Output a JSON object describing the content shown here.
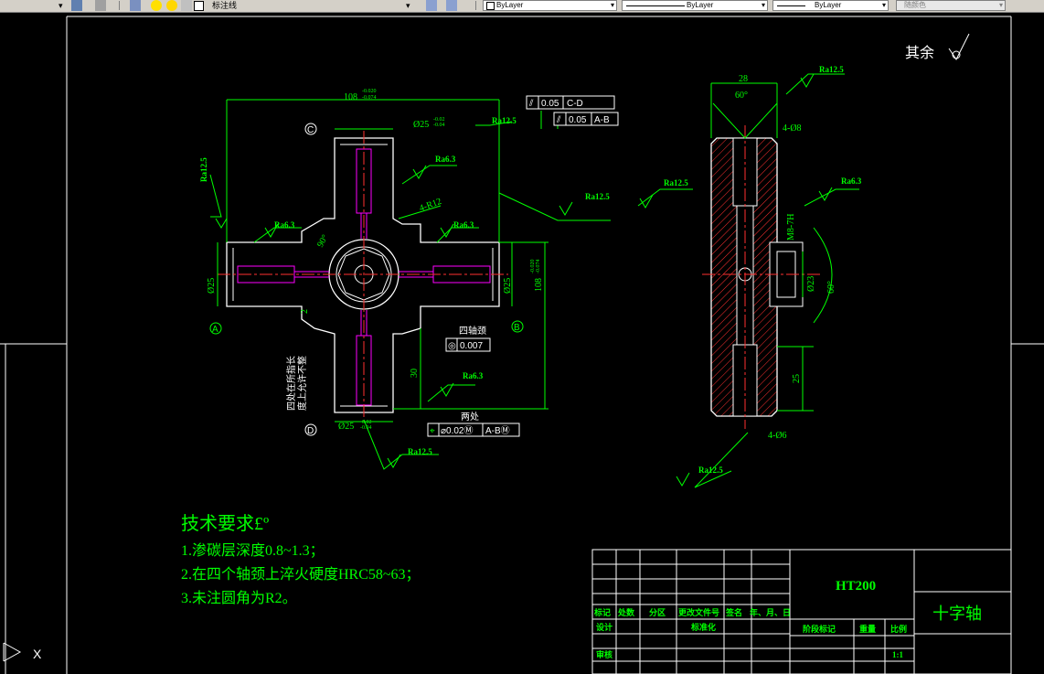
{
  "toolbar": {
    "layer_name": "标注线",
    "color_combo": "ByLayer",
    "linetype_combo": "ByLayer",
    "lineweight_combo": "ByLayer",
    "plotstyle_combo": "随颜色"
  },
  "drawing": {
    "surface_note_label": "其余",
    "dims": {
      "total_length": "108",
      "total_tol_upper": "-0.020",
      "total_tol_lower": "-0.074",
      "total_length_v": "108",
      "total_tol_v_upper": "-0.020",
      "total_tol_v_lower": "-0.074",
      "journal_dia": "Ø25",
      "journal_tol_upper": "-0.02",
      "journal_tol_lower": "-0.04",
      "r12": "4-R12",
      "angle90": "90°",
      "dim30": "30",
      "dim2": "2",
      "side_width": "28",
      "side_angle": "60°",
      "hole_4_8": "4-Ø8",
      "thread": "M8-7H",
      "dia23": "Ø23",
      "angle60": "60°",
      "dim25": "25",
      "hole_4_6": "4-Ø6"
    },
    "datums": [
      "C",
      "D",
      "A",
      "B"
    ],
    "tolerance_frames": [
      {
        "symbol": "⫽",
        "value": "0.05",
        "datum": "C-D"
      },
      {
        "symbol": "⫽",
        "value": "0.05",
        "datum": "A-B"
      },
      {
        "symbol": "◎",
        "value": "0.007",
        "datum": ""
      },
      {
        "symbol": "⌖",
        "value": "⌀0.02Ⓜ",
        "datum": "A-BⓂ"
      }
    ],
    "notes": {
      "four_journals": "四轴颈",
      "two_places": "两处",
      "vertical_note_1": "四处在所指长",
      "vertical_note_2": "度上允许不整"
    },
    "roughness": [
      "Ra12.5",
      "Ra6.3",
      "Ra6.3",
      "Ra6.3",
      "Ra12.5",
      "Ra12.5",
      "Ra6.3",
      "Ra12.5",
      "Ra12.5",
      "Ra12.5",
      "Ra12.5",
      "Ra6.3",
      "Ra12.5"
    ],
    "tech_requirements": {
      "title": "技术要求£º",
      "items": [
        "1.渗碳层深度0.8~1.3；",
        "2.在四个轴颈上淬火硬度HRC58~63；",
        "3.未注圆角为R2。"
      ]
    },
    "title_block": {
      "material": "HT200",
      "part_name": "十字轴",
      "scale": "1:1",
      "col_labels": [
        "标记",
        "处数",
        "分区",
        "更改文件号",
        "签名",
        "年、月、日"
      ],
      "design": "设计",
      "standardize": "标准化",
      "review": "审核",
      "stage_mark": "阶段标记",
      "weight": "重量",
      "ratio": "比例"
    }
  },
  "ucs_icon": {
    "x_label": "X"
  },
  "colors": {
    "background": "#000000",
    "dimension": "#00ff00",
    "outline": "#ffffff",
    "centerline": "#ff0000",
    "hidden": "#ff00ff",
    "hatch": "#ff0000"
  }
}
